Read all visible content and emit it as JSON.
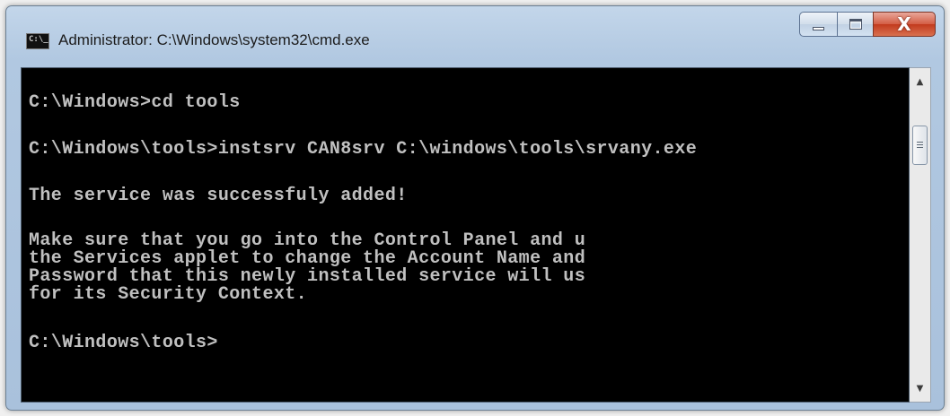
{
  "window": {
    "title": "Administrator: C:\\Windows\\system32\\cmd.exe",
    "app_icon_text": "C:\\_"
  },
  "caption_buttons": {
    "close_glyph": "X"
  },
  "console": {
    "lines": [
      "C:\\Windows>cd tools",
      "C:\\Windows\\tools>instsrv CAN8srv C:\\windows\\tools\\srvany.exe",
      "The service was successfuly added!",
      "Make sure that you go into the Control Panel and u",
      "the Services applet to change the Account Name and",
      "Password that this newly installed service will us",
      "for its Security Context.",
      "C:\\Windows\\tools>"
    ]
  },
  "scrollbar": {
    "up_arrow": "▲",
    "down_arrow": "▼"
  },
  "colors": {
    "console_bg": "#000000",
    "console_text": "#c0c0c0",
    "close_button": "#c23a1d",
    "title_bar": "#b9cfe6"
  }
}
